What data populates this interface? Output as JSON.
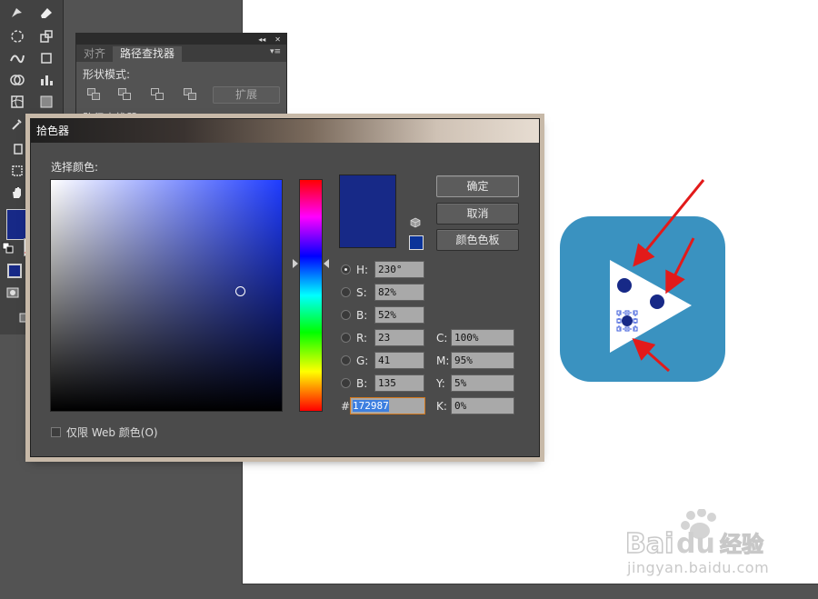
{
  "colors": {
    "current": "#172987",
    "web_safe": "#0b3399",
    "icon_bg": "#3a92c0",
    "arrow": "#e21a1a"
  },
  "pathfinder_panel": {
    "tabs": [
      {
        "label": "对齐"
      },
      {
        "label": "路径查找器"
      }
    ],
    "shape_modes_label": "形状模式:",
    "expand_label": "扩展",
    "pathfinders_label": "路径查找器:"
  },
  "picker": {
    "title": "拾色器",
    "choose_label": "选择颜色:",
    "web_only_label": "仅限 Web 颜色(O)",
    "buttons": {
      "ok": "确定",
      "cancel": "取消",
      "swatches": "颜色色板"
    },
    "hsb": [
      {
        "label": "H:",
        "value": "230°",
        "selected": true
      },
      {
        "label": "S:",
        "value": "82%",
        "selected": false
      },
      {
        "label": "B:",
        "value": "52%",
        "selected": false
      }
    ],
    "rgb": [
      {
        "label": "R:",
        "value": "23"
      },
      {
        "label": "G:",
        "value": "41"
      },
      {
        "label": "B:",
        "value": "135"
      }
    ],
    "cmyk": [
      {
        "label": "C:",
        "value": "100%"
      },
      {
        "label": "M:",
        "value": "95%"
      },
      {
        "label": "Y:",
        "value": "5%"
      },
      {
        "label": "K:",
        "value": "0%"
      }
    ],
    "hex_label": "#",
    "hex_value": "172987"
  },
  "watermark": {
    "logo": "Baidu经验",
    "url": "jingyan.baidu.com"
  }
}
